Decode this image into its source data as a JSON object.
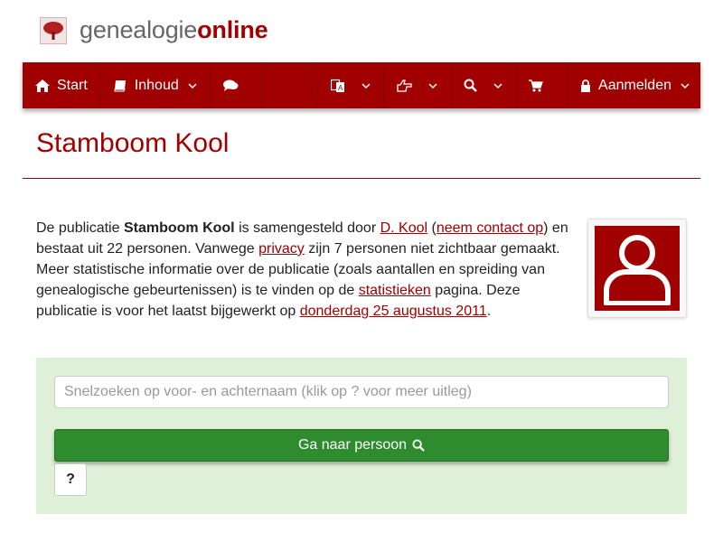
{
  "logo": {
    "text_main": "genealogie",
    "text_accent": "online",
    "icon": "tree-icon"
  },
  "nav": {
    "start_label": "Start",
    "inhoud_label": "Inhoud",
    "login_label": "Aanmelden",
    "icons": [
      "home-icon",
      "book-icon",
      "comments-icon",
      "language-icon",
      "hand-point-icon",
      "search-icon",
      "cart-icon",
      "lock-icon"
    ]
  },
  "page": {
    "title": "Stamboom Kool"
  },
  "intro": {
    "p1": "De publicatie ",
    "pub_name": "Stamboom Kool",
    "p2": " is samengesteld door ",
    "author": "D. Kool",
    "p3": " (",
    "contact": "neem contact op",
    "p4": ") en bestaat uit 22 personen. Vanwege ",
    "privacy": "privacy",
    "p5": " zijn 7 personen niet zichtbaar gemaakt. Meer statistische informatie over de publicatie (zoals aantallen en spreiding van genealogische gebeurtenissen) is te vinden op de ",
    "stats": "statistieken",
    "p6": " pagina. Deze publicatie is voor het laatst bijgewerkt op ",
    "updated": "donderdag 25 augustus 2011",
    "p7": "."
  },
  "search": {
    "placeholder": "Snelzoeken op voor- en achternaam (klik op ? voor meer uitleg)",
    "go_label": "Ga naar persoon",
    "help_label": "?"
  },
  "colors": {
    "brand": "#a00000",
    "panel": "#dff0d8",
    "button": "#2e8b2e"
  }
}
